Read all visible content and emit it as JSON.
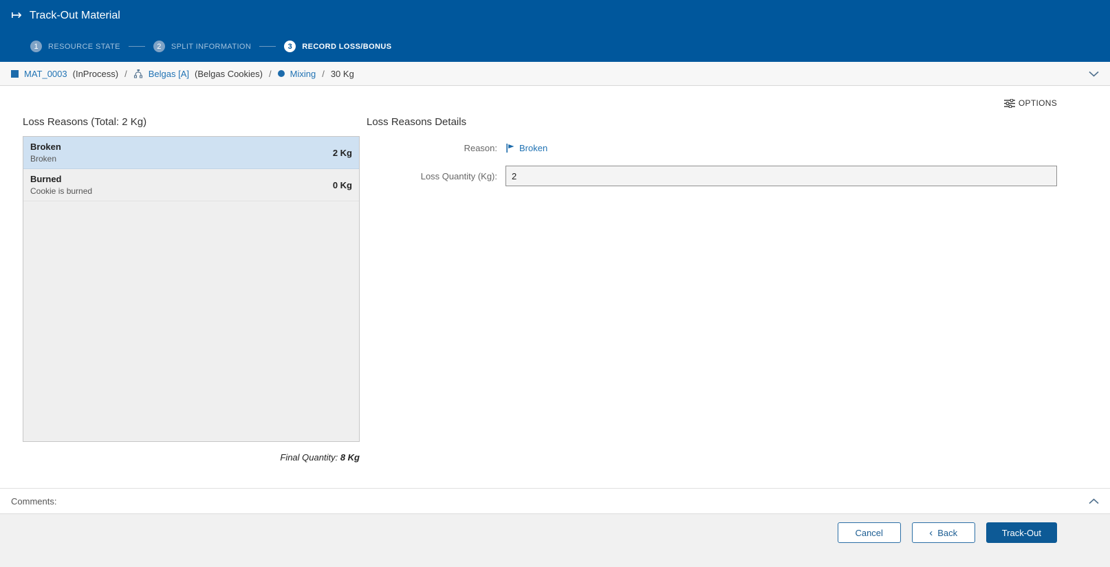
{
  "icons": {
    "track_out_glyph": "↦",
    "back_chevron_glyph": "‹"
  },
  "header": {
    "title": "Track-Out Material",
    "steps": [
      {
        "number": "1",
        "label": "RESOURCE STATE"
      },
      {
        "number": "2",
        "label": "SPLIT INFORMATION"
      },
      {
        "number": "3",
        "label": "RECORD LOSS/BONUS"
      }
    ]
  },
  "breadcrumb": {
    "material_id": "MAT_0003",
    "material_state": "(InProcess)",
    "sep": "/",
    "equipment": "Belgas [A]",
    "equipment_desc": "(Belgas Cookies)",
    "operation": "Mixing",
    "quantity": "30 Kg"
  },
  "toolbar": {
    "options_label": "OPTIONS"
  },
  "loss_reasons": {
    "title": "Loss Reasons (Total: 2 Kg)",
    "items": [
      {
        "name": "Broken",
        "description": "Broken",
        "quantity": "2 Kg"
      },
      {
        "name": "Burned",
        "description": "Cookie is burned",
        "quantity": "0 Kg"
      }
    ],
    "final_quantity_label": "Final Quantity:",
    "final_quantity_value": "8 Kg"
  },
  "details": {
    "title": "Loss Reasons Details",
    "reason_label": "Reason:",
    "reason_value": "Broken",
    "loss_quantity_label": "Loss Quantity (Kg):",
    "loss_quantity_value": "2"
  },
  "comments": {
    "label": "Comments:"
  },
  "footer": {
    "cancel_label": "Cancel",
    "back_label": "Back",
    "trackout_label": "Track-Out"
  }
}
